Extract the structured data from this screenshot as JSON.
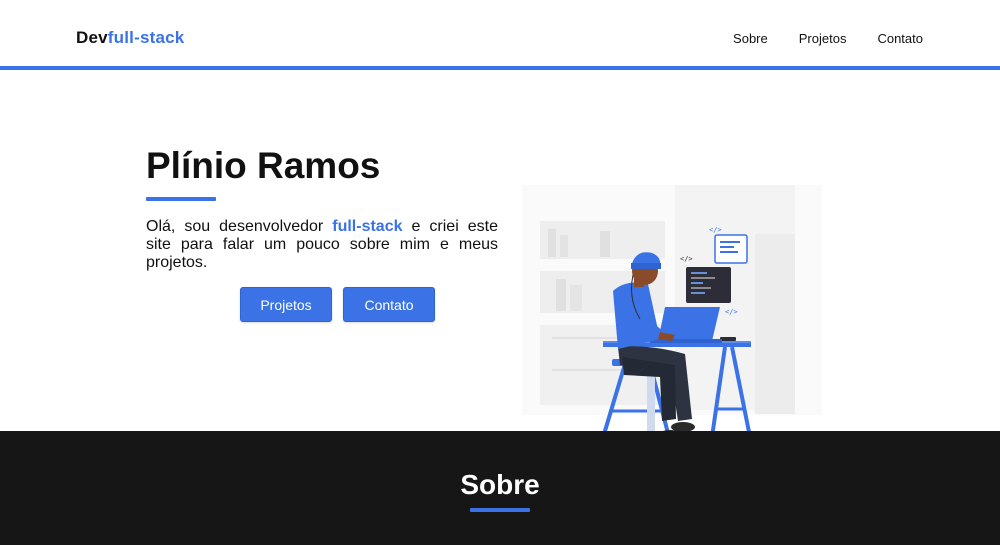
{
  "header": {
    "logo_prefix": "Dev",
    "logo_accent": "full-stack",
    "nav": [
      {
        "label": "Sobre"
      },
      {
        "label": "Projetos"
      },
      {
        "label": "Contato"
      }
    ]
  },
  "hero": {
    "title": "Plínio Ramos",
    "intro_before": "Olá, sou desenvolvedor ",
    "intro_highlight": "full-stack",
    "intro_after": " e criei este site para falar um pouco sobre mim e meus projetos.",
    "buttons": {
      "projects": "Projetos",
      "contact": "Contato"
    },
    "illustration_icon": "developer-at-desk-illustration"
  },
  "about": {
    "title": "Sobre"
  },
  "colors": {
    "accent": "#3b73e6",
    "dark_section": "#161616"
  }
}
